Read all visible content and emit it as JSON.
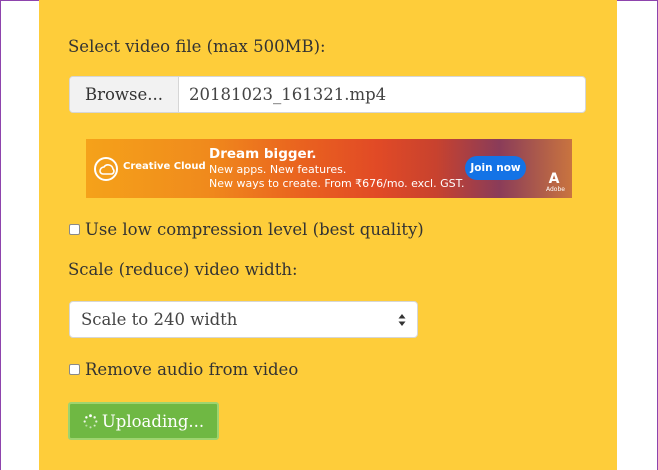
{
  "form": {
    "file_label": "Select video file (max 500MB):",
    "browse_label": "Browse...",
    "file_name": "20181023_161321.mp4",
    "low_compression_label": "Use low compression level (best quality)",
    "scale_label": "Scale (reduce) video width:",
    "scale_selected": "Scale to 240 width",
    "remove_audio_label": "Remove audio from video",
    "upload_label": "Uploading..."
  },
  "ad": {
    "brand": "Creative Cloud",
    "headline": "Dream bigger.",
    "line2": "New apps. New features.",
    "line3": "New ways to create. From ₹676/mo. excl. GST.",
    "cta": "Join now",
    "adobe_mark": "A",
    "adobe_word": "Adobe"
  },
  "colors": {
    "panel": "#fecd3a",
    "upload_button": "#6fb843",
    "ad_cta": "#1473e6"
  },
  "icons": {
    "spinner": "spinner-icon",
    "select_arrows": "sort-arrows-icon",
    "cc_logo": "creative-cloud-icon"
  }
}
